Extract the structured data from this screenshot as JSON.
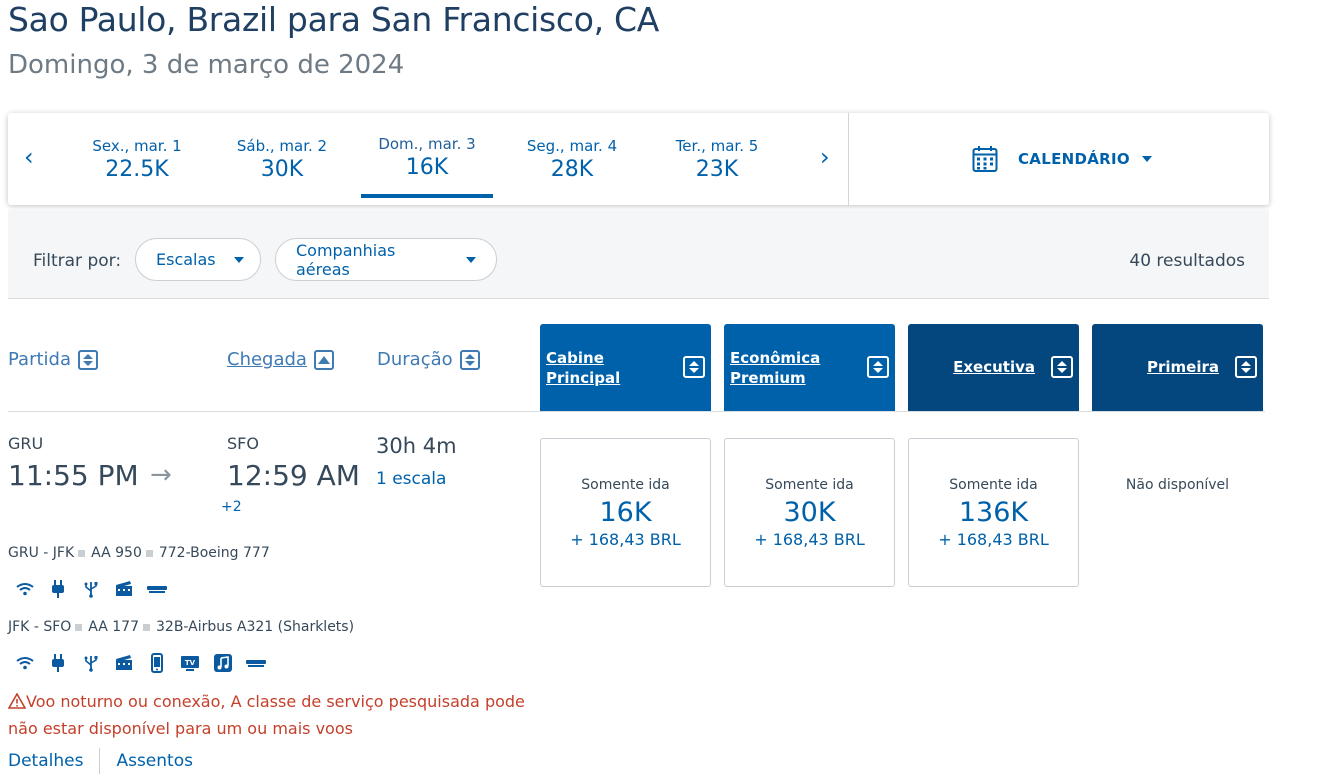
{
  "header": {
    "title": "Sao Paulo, Brazil para San Francisco, CA",
    "subtitle": "Domingo, 3 de março de 2024"
  },
  "date_strip": {
    "prev": "‹",
    "next": "›",
    "items": [
      {
        "date": "Sex., mar. 1",
        "price": "22.5K"
      },
      {
        "date": "Sáb., mar. 2",
        "price": "30K"
      },
      {
        "date": "Dom., mar. 3",
        "price": "16K",
        "selected": true
      },
      {
        "date": "Seg., mar. 4",
        "price": "28K"
      },
      {
        "date": "Ter., mar. 5",
        "price": "23K"
      }
    ],
    "calendar_label": "CALENDÁRIO"
  },
  "filters": {
    "label": "Filtrar por:",
    "stops": "Escalas",
    "airlines": "Companhias aéreas",
    "results": "40 resultados"
  },
  "columns": {
    "departure": "Partida",
    "arrival": "Chegada",
    "duration": "Duração",
    "cabins": [
      {
        "line1": "Cabine",
        "line2": "Principal",
        "color": "#0061ab"
      },
      {
        "line1": "Econômica",
        "line2": "Premium",
        "color": "#0061ab"
      },
      {
        "line1": "Executiva",
        "line2": "",
        "color": "#04467e"
      },
      {
        "line1": "Primeira",
        "line2": "",
        "color": "#04467e"
      }
    ]
  },
  "flight": {
    "origin": "GRU",
    "depart_time": "11:55 PM",
    "destination": "SFO",
    "arrive_time": "12:59 AM",
    "day_offset": "+2",
    "duration": "30h 4m",
    "stops": "1 escala",
    "segments": [
      {
        "route": "GRU - JFK",
        "flight": "AA 950",
        "aircraft": "772-Boeing 777",
        "amenities": [
          "wifi-icon",
          "power-outlet-icon",
          "usb-icon",
          "entertainment-icon",
          "seat-icon"
        ]
      },
      {
        "route": "JFK - SFO",
        "flight": "AA 177",
        "aircraft": "32B-Airbus A321 (Sharklets)",
        "amenities": [
          "wifi-icon",
          "power-outlet-icon",
          "usb-icon",
          "entertainment-icon",
          "mobile-icon",
          "tv-icon",
          "music-icon",
          "seat-icon"
        ]
      }
    ],
    "warning": "Voo noturno ou conexão, A classe de serviço pesquisada pode não estar disponível para um ou mais voos",
    "details_link": "Detalhes",
    "seats_link": "Assentos",
    "fares": [
      {
        "label": "Somente ida",
        "points": "16K",
        "tax": "+ 168,43 BRL"
      },
      {
        "label": "Somente ida",
        "points": "30K",
        "tax": "+ 168,43 BRL"
      },
      {
        "label": "Somente ida",
        "points": "136K",
        "tax": "+ 168,43 BRL"
      }
    ],
    "unavailable": "Não disponível"
  }
}
